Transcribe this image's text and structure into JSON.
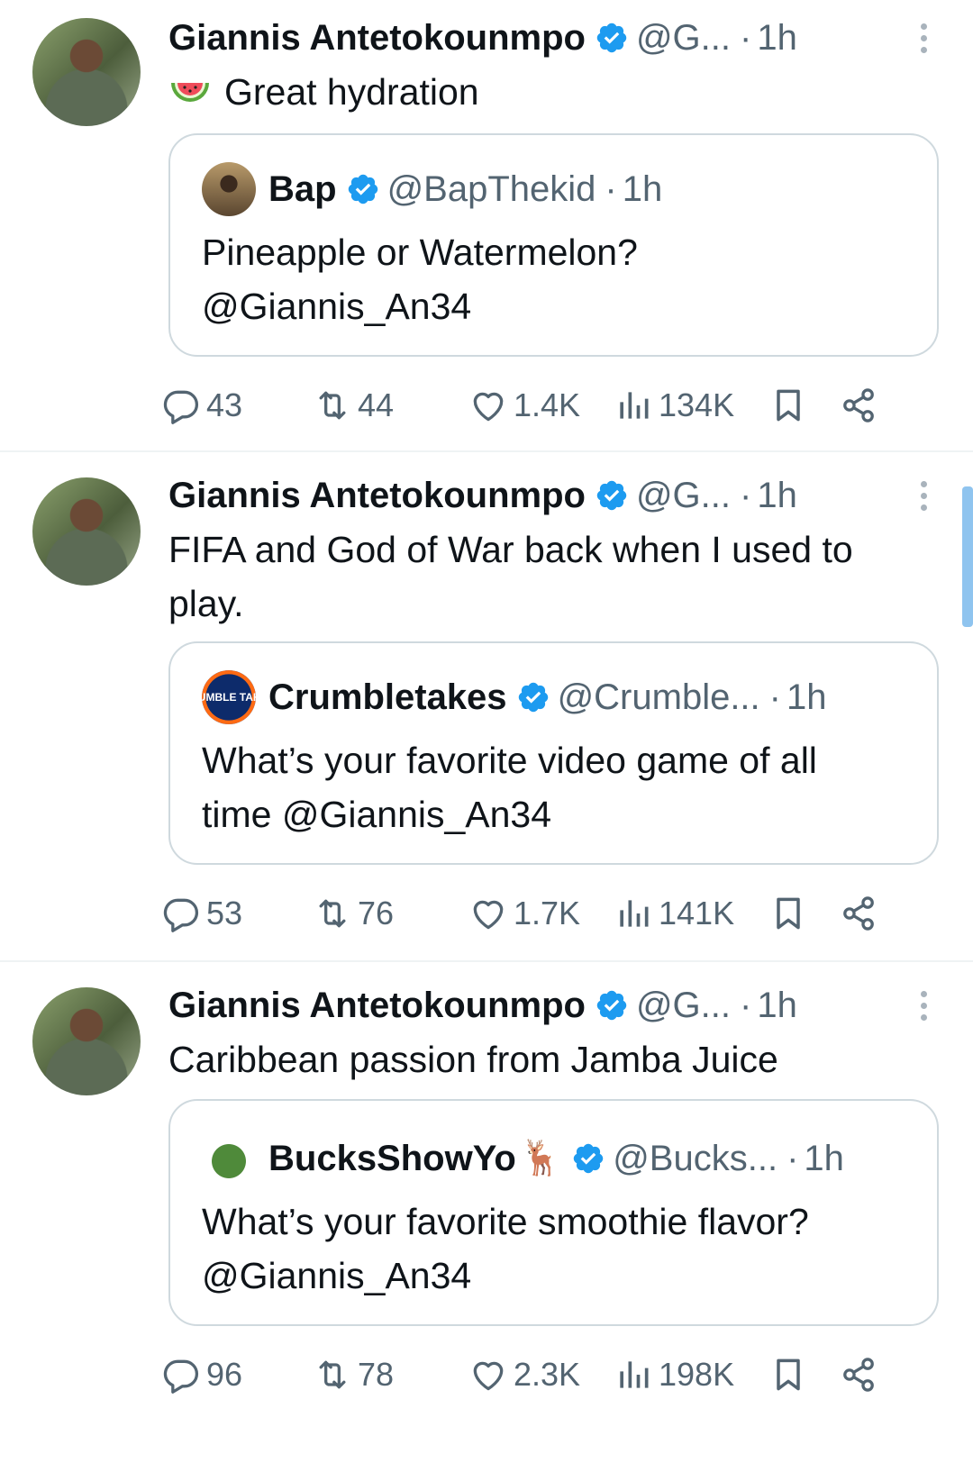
{
  "tweets": [
    {
      "author": "Giannis Antetokounmpo",
      "handle": "@G...",
      "dot": "·",
      "time": "1h",
      "emoji": "watermelon-emoji",
      "text": "Great hydration",
      "quote": {
        "name": "Bap",
        "handle": "@BapThekid",
        "dot": "·",
        "time": "1h",
        "text_lines": [
          "Pineapple or Watermelon?",
          "@Giannis_An34"
        ]
      },
      "stats": {
        "replies": "43",
        "reposts": "44",
        "likes": "1.4K",
        "views": "134K"
      }
    },
    {
      "author": "Giannis Antetokounmpo",
      "handle": "@G...",
      "dot": "·",
      "time": "1h",
      "text_lines": [
        "FIFA and God of War back when I used to",
        "play."
      ],
      "quote": {
        "name": "Crumbletakes",
        "avatar_text": "CRUMBLE TAKES",
        "handle": "@Crumble...",
        "dot": "·",
        "time": "1h",
        "text_lines": [
          "What’s your favorite video game of all",
          "time @Giannis_An34"
        ]
      },
      "stats": {
        "replies": "53",
        "reposts": "76",
        "likes": "1.7K",
        "views": "141K"
      }
    },
    {
      "author": "Giannis Antetokounmpo",
      "handle": "@G...",
      "dot": "·",
      "time": "1h",
      "text": "Caribbean passion from Jamba Juice",
      "quote": {
        "name": "BucksShowYo",
        "deer": "🦌",
        "handle": "@Bucks...",
        "dot": "·",
        "time": "1h",
        "text_lines": [
          "What’s your favorite smoothie flavor?",
          "@Giannis_An34"
        ]
      },
      "stats": {
        "replies": "96",
        "reposts": "78",
        "likes": "2.3K",
        "views": "198K"
      }
    }
  ],
  "colors": {
    "verified": "#1d9bf0",
    "text": "#0f1419",
    "secondary": "#536471",
    "border": "#cfd9de",
    "scrollbar": "#8fc4ef"
  }
}
